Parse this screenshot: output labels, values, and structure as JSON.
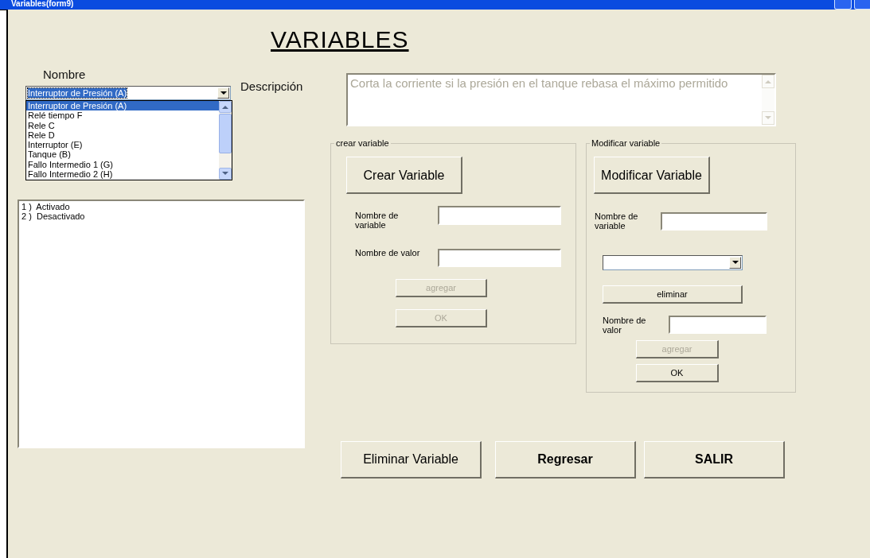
{
  "window": {
    "title": "Variables(form9)"
  },
  "heading": "VARIABLES",
  "nombre": {
    "label": "Nombre",
    "value": "Interruptor de Presión (A)",
    "expanded": true,
    "options": [
      {
        "label": "Interruptor de Presión (A)",
        "selected": true
      },
      {
        "label": "Relé tiempo F",
        "selected": false
      },
      {
        "label": "Rele C",
        "selected": false
      },
      {
        "label": "Rele D",
        "selected": false
      },
      {
        "label": "Interruptor (E)",
        "selected": false
      },
      {
        "label": "Tanque (B)",
        "selected": false
      },
      {
        "label": "Fallo Intermedio 1 (G)",
        "selected": false
      },
      {
        "label": "Fallo Intermedio 2 (H)",
        "selected": false
      }
    ]
  },
  "descripcion": {
    "label": "Descripción",
    "value": "Corta la corriente si la presión en el tanque rebasa el máximo permitido",
    "disabled": true
  },
  "values_list": [
    "1 )  Activado",
    "2 )  Desactivado"
  ],
  "crear_group": {
    "title": "crear variable",
    "button": "Crear Variable",
    "variable_label": "Nombre de variable",
    "valor_label": "Nombre de valor",
    "actions": [
      {
        "label": "agregar",
        "disabled": true
      },
      {
        "label": "OK",
        "disabled": true
      }
    ]
  },
  "modificar_group": {
    "title": "Modificar variable",
    "button": "Modificar Variable",
    "variable_label": "Nombre de variable",
    "eliminar": "eliminar",
    "valor_label": "Nombre de valor",
    "actions": [
      {
        "label": "agregar",
        "disabled": true
      },
      {
        "label": "OK",
        "disabled": false
      }
    ]
  },
  "buttons": [
    {
      "label": "Eliminar Variable",
      "bold": false
    },
    {
      "label": "Regresar",
      "bold": true
    },
    {
      "label": "SALIR",
      "bold": true
    }
  ]
}
